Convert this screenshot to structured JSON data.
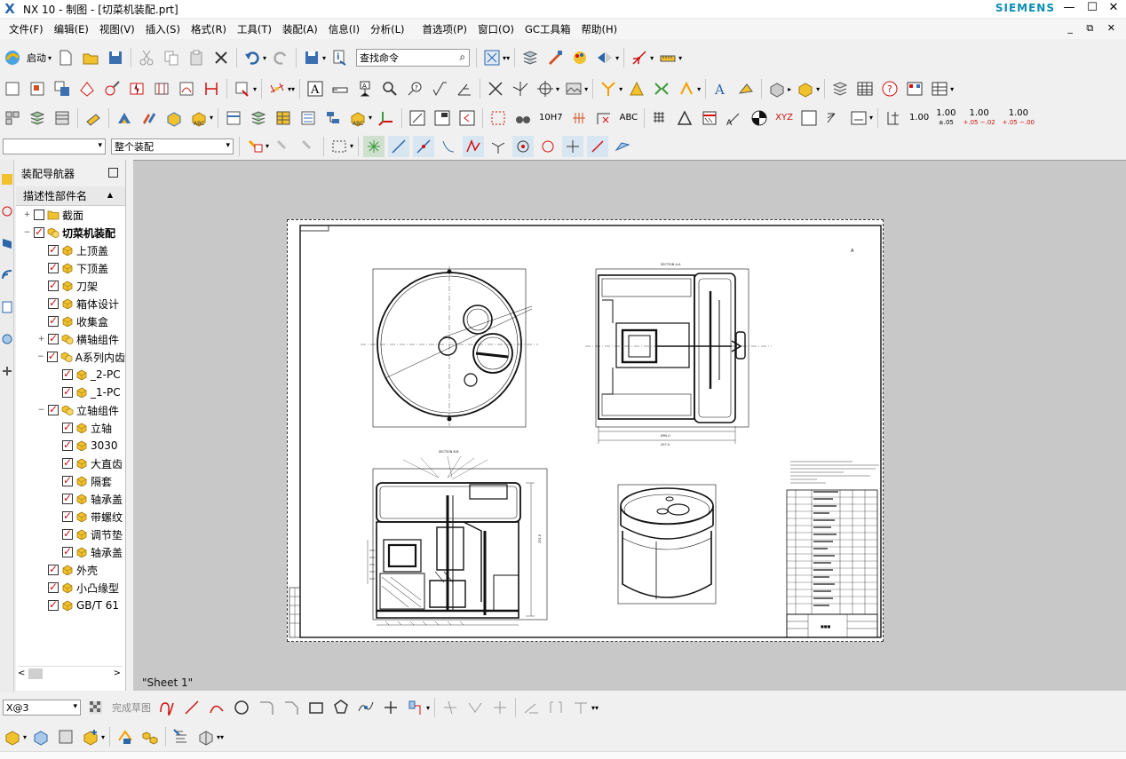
{
  "window": {
    "app_logo": "X",
    "title": "NX 10 - 制图 - [切菜机装配.prt]",
    "brand": "SIEMENS",
    "minimize": "—",
    "maximize": "☐",
    "close": "✕"
  },
  "menu": {
    "items": [
      "文件(F)",
      "编辑(E)",
      "视图(V)",
      "插入(S)",
      "格式(R)",
      "工具(T)",
      "装配(A)",
      "信息(I)",
      "分析(L)",
      "首选项(P)",
      "窗口(O)",
      "GC工具箱",
      "帮助(H)"
    ],
    "right_controls": "_ ⧉ ✕"
  },
  "toolbar": {
    "start_label": "启动",
    "search_placeholder": "查找命令",
    "search_icon": "magnifier-icon",
    "tolerance_1": "1.00",
    "tolerance_2_main": "1.00",
    "tolerance_2_sub": "±.05",
    "tolerance_3_main": "1.00",
    "tolerance_3_sub": "+.05 −.02",
    "tolerance_4_main": "1.00",
    "tolerance_4_sub": "+.05 −.00",
    "fit_text": "10H7",
    "abc_text": "ABC",
    "xyz_text": "XYZ"
  },
  "selection_bar": {
    "filter_value": "",
    "scope_value": "整个装配"
  },
  "navigator": {
    "title": "装配导航器",
    "column_header": "描述性部件名",
    "items": [
      {
        "label": "截面",
        "level": 0,
        "expander": "+",
        "checked": false,
        "icon": "folder-icon",
        "bold": false
      },
      {
        "label": "切菜机装配",
        "level": 0,
        "expander": "−",
        "checked": true,
        "icon": "assembly-icon",
        "bold": true
      },
      {
        "label": "上顶盖",
        "level": 1,
        "expander": "",
        "checked": true,
        "icon": "part-icon",
        "bold": false
      },
      {
        "label": "下顶盖",
        "level": 1,
        "expander": "",
        "checked": true,
        "icon": "part-icon",
        "bold": false
      },
      {
        "label": "刀架",
        "level": 1,
        "expander": "",
        "checked": true,
        "icon": "part-icon",
        "bold": false
      },
      {
        "label": "箱体设计",
        "level": 1,
        "expander": "",
        "checked": true,
        "icon": "part-icon",
        "bold": false
      },
      {
        "label": "收集盒",
        "level": 1,
        "expander": "",
        "checked": true,
        "icon": "part-icon",
        "bold": false
      },
      {
        "label": "横轴组件",
        "level": 1,
        "expander": "+",
        "checked": true,
        "icon": "assembly-icon",
        "bold": false
      },
      {
        "label": "A系列内齿",
        "level": 1,
        "expander": "−",
        "checked": true,
        "icon": "assembly-icon",
        "bold": false
      },
      {
        "label": "_2-PC",
        "level": 2,
        "expander": "",
        "checked": true,
        "icon": "part-icon",
        "bold": false
      },
      {
        "label": "_1-PC",
        "level": 2,
        "expander": "",
        "checked": true,
        "icon": "part-icon",
        "bold": false
      },
      {
        "label": "立轴组件",
        "level": 1,
        "expander": "−",
        "checked": true,
        "icon": "assembly-icon",
        "bold": false
      },
      {
        "label": "立轴",
        "level": 2,
        "expander": "",
        "checked": true,
        "icon": "part-icon",
        "bold": false
      },
      {
        "label": "3030",
        "level": 2,
        "expander": "",
        "checked": true,
        "icon": "part-icon",
        "bold": false
      },
      {
        "label": "大直齿",
        "level": 2,
        "expander": "",
        "checked": true,
        "icon": "part-icon",
        "bold": false
      },
      {
        "label": "隔套",
        "level": 2,
        "expander": "",
        "checked": true,
        "icon": "part-icon",
        "bold": false
      },
      {
        "label": "轴承盖",
        "level": 2,
        "expander": "",
        "checked": true,
        "icon": "part-icon",
        "bold": false
      },
      {
        "label": "带螺纹",
        "level": 2,
        "expander": "",
        "checked": true,
        "icon": "part-icon",
        "bold": false
      },
      {
        "label": "调节垫",
        "level": 2,
        "expander": "",
        "checked": true,
        "icon": "part-icon",
        "bold": false
      },
      {
        "label": "轴承盖",
        "level": 2,
        "expander": "",
        "checked": true,
        "icon": "part-icon",
        "bold": false
      },
      {
        "label": "外壳",
        "level": 1,
        "expander": "",
        "checked": true,
        "icon": "part-icon",
        "bold": false
      },
      {
        "label": "小凸缘型",
        "level": 1,
        "expander": "",
        "checked": true,
        "icon": "part-icon",
        "bold": false
      },
      {
        "label": "GB/T 61",
        "level": 1,
        "expander": "",
        "checked": true,
        "icon": "part-icon",
        "bold": false
      }
    ],
    "scroll_left": "<",
    "scroll_right": ">"
  },
  "drawing": {
    "sheet_label": "\"Sheet 1\""
  },
  "bottom_toolbar": {
    "layer_combo": "X@3",
    "finish_sketch": "完成草图"
  },
  "colors": {
    "check_red": "#d01010",
    "cube_yellow": "#f2c12e",
    "canvas_grey": "#c8c8c8",
    "siemens_teal": "#0b8fb3"
  }
}
